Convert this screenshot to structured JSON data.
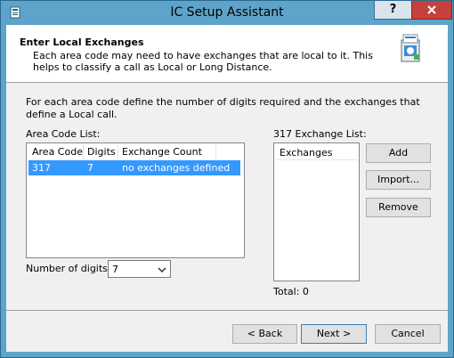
{
  "window": {
    "title": "IC Setup Assistant",
    "help_label": "?",
    "close_label": "x"
  },
  "header": {
    "title": "Enter Local Exchanges",
    "description": "Each area code may need to have exchanges that are local to it. This helps to classify a call as Local or Long Distance."
  },
  "intro": "For each area code define the number of digits required and the exchanges that define a Local call.",
  "area_codes": {
    "label": "Area Code List:",
    "columns": [
      "Area Code",
      "Digits",
      "Exchange Count"
    ],
    "rows": [
      {
        "area_code": "317",
        "digits": "7",
        "exchange_count": "no exchanges defined",
        "selected": true
      }
    ]
  },
  "digits": {
    "label": "Number of digits:",
    "value": "7"
  },
  "exchanges": {
    "label": "317 Exchange List:",
    "column": "Exchanges",
    "total": "Total: 0"
  },
  "buttons": {
    "add": "Add",
    "import": "Import...",
    "remove": "Remove",
    "back": "< Back",
    "next": "Next >",
    "cancel": "Cancel"
  },
  "colors": {
    "title_bar": "#5ea3c9",
    "selection": "#3399ff",
    "close_button": "#c7403a"
  },
  "icons": [
    "app-icon",
    "setup-package-icon",
    "chevron-down-icon"
  ]
}
